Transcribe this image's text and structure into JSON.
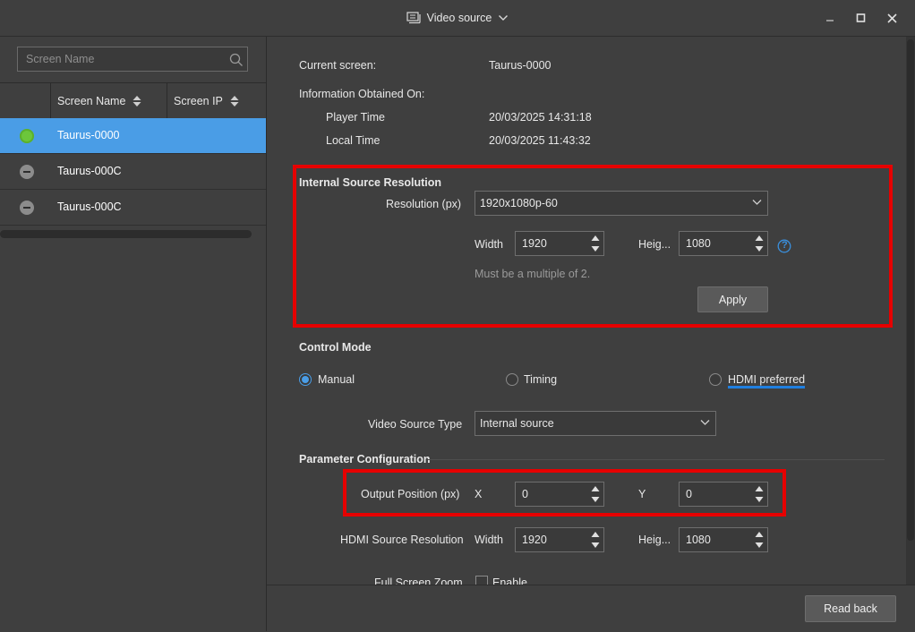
{
  "window": {
    "title": "Video source",
    "minimize_label": "–",
    "maximize_label": "□",
    "close_label": "✕"
  },
  "sidebar": {
    "search": {
      "placeholder": "Screen Name",
      "value": ""
    },
    "columns": [
      "Screen Name",
      "Screen IP"
    ],
    "screens": [
      {
        "name": "Taurus-0000",
        "status": "online",
        "selected": true
      },
      {
        "name": "Taurus-000C",
        "status": "offline",
        "selected": false
      },
      {
        "name": "Taurus-000C",
        "status": "offline",
        "selected": false
      }
    ]
  },
  "info": {
    "current_screen_label": "Current screen:",
    "current_screen_value": "Taurus-0000",
    "obtained_label": "Information Obtained On:",
    "player_time_label": "Player Time",
    "player_time_value": "20/03/2025 14:31:18",
    "local_time_label": "Local Time",
    "local_time_value": "20/03/2025 11:43:32"
  },
  "internal_source": {
    "heading": "Internal Source Resolution",
    "resolution_label": "Resolution (px)",
    "resolution_value": "1920x1080p-60",
    "width_label": "Width",
    "width_value": "1920",
    "height_label": "Heig...",
    "height_value": "1080",
    "help_label": "?",
    "hint": "Must be a multiple of 2.",
    "apply_label": "Apply"
  },
  "control_mode": {
    "heading": "Control Mode",
    "options": [
      "Manual",
      "Timing",
      "HDMI preferred"
    ],
    "selected": "Manual",
    "video_source_type_label": "Video Source Type",
    "video_source_type_value": "Internal source"
  },
  "parameter_config": {
    "heading": "Parameter Configuration",
    "output_position_label": "Output Position (px)",
    "x_label": "X",
    "x_value": "0",
    "y_label": "Y",
    "y_value": "0",
    "hdmi_res_label": "HDMI Source Resolution",
    "hdmi_width_label": "Width",
    "hdmi_width_value": "1920",
    "hdmi_height_label": "Heig...",
    "hdmi_height_value": "1080",
    "zoom_label": "Full Screen Zoom",
    "zoom_enable_label": "Enable"
  },
  "footer": {
    "read_back_label": "Read back"
  },
  "colors": {
    "accent": "#4a9de6",
    "highlight": "#e60000",
    "online": "#6cc63b"
  }
}
